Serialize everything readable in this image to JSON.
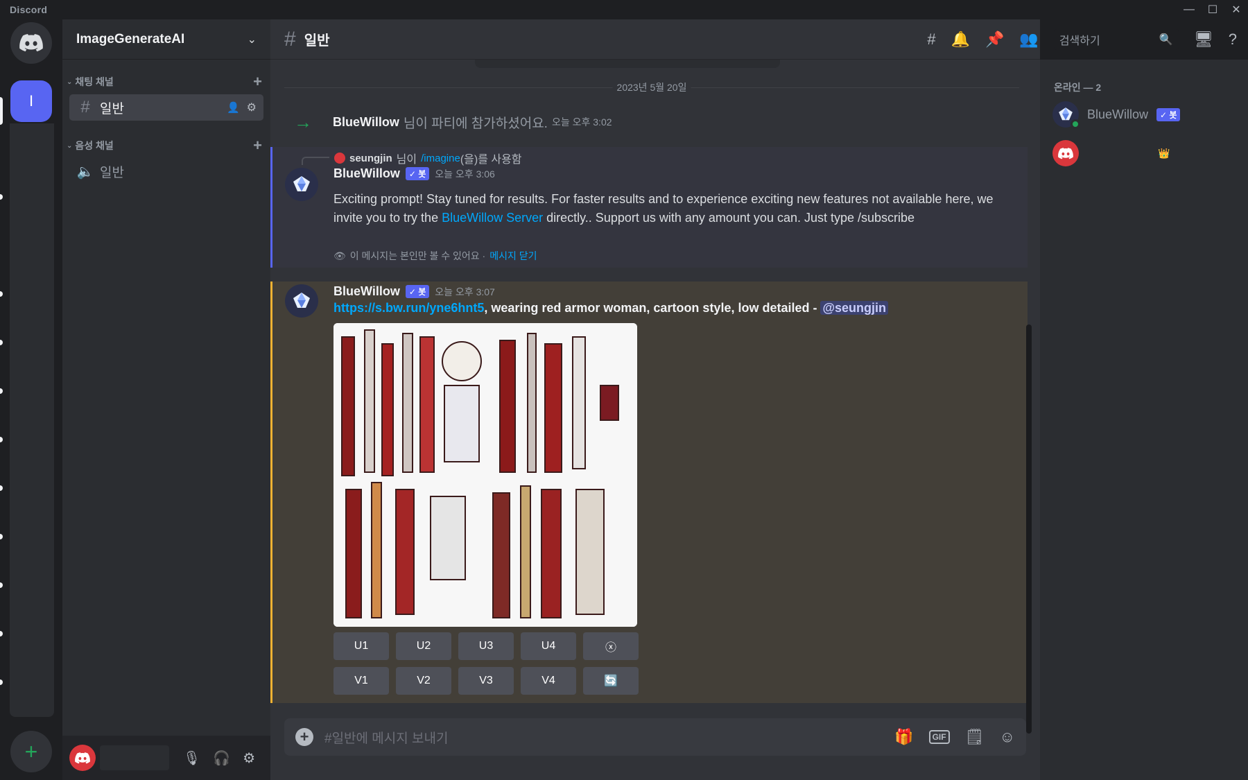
{
  "app": {
    "name": "Discord"
  },
  "guilds": {
    "active_initial": "I"
  },
  "server": {
    "name": "ImageGenerateAI"
  },
  "sidebar": {
    "text_category": "채팅 채널",
    "voice_category": "음성 채널",
    "text_channel": "일반",
    "voice_channel": "일반"
  },
  "channel": {
    "name": "일반"
  },
  "search": {
    "placeholder": "검색하기"
  },
  "date_divider": "2023년 5월 20일",
  "system_message": {
    "author": "BlueWillow",
    "text": "님이 파티에 참가하셨어요.",
    "time": "오늘 오후 3:02"
  },
  "message1": {
    "reply_user": "seungjin",
    "reply_mid": "님이",
    "reply_command": "/imagine",
    "reply_suffix": "(을)를 사용함",
    "author": "BlueWillow",
    "badge": "✓ 봇",
    "time": "오늘 오후 3:06",
    "text_a": "Exciting prompt! Stay tuned for results. For faster results and to experience exciting new features not available here, we invite you to try the ",
    "link": "BlueWillow Server",
    "text_b": " directly.. Support us with any amount you can. Just type /subscribe",
    "ephemeral_note": "이 메시지는 본인만 볼 수 있어요 ·",
    "dismiss": "메시지 닫기"
  },
  "message2": {
    "author": "BlueWillow",
    "badge": "✓ 봇",
    "time": "오늘 오후 3:07",
    "link": "https://s.bw.run/yne6hnt5",
    "prompt": ", wearing red armor woman, cartoon style, low detailed - ",
    "mention": "@seungjin",
    "upscale_buttons": [
      "U1",
      "U2",
      "U3",
      "U4"
    ],
    "variation_buttons": [
      "V1",
      "V2",
      "V3",
      "V4"
    ],
    "close_glyph": "ⓧ",
    "reroll_glyph": "🔄"
  },
  "composer": {
    "placeholder": "#일반에 메시지 보내기",
    "gif_label": "GIF"
  },
  "members": {
    "header": "온라인 — 2",
    "bot_name": "BlueWillow",
    "bot_badge": "✓ 봇",
    "owner_glyph": "👑"
  },
  "colors": {
    "accent": "#5865f2",
    "link": "#00a8fc",
    "highlight": "#f0b232",
    "online": "#23a55a"
  }
}
